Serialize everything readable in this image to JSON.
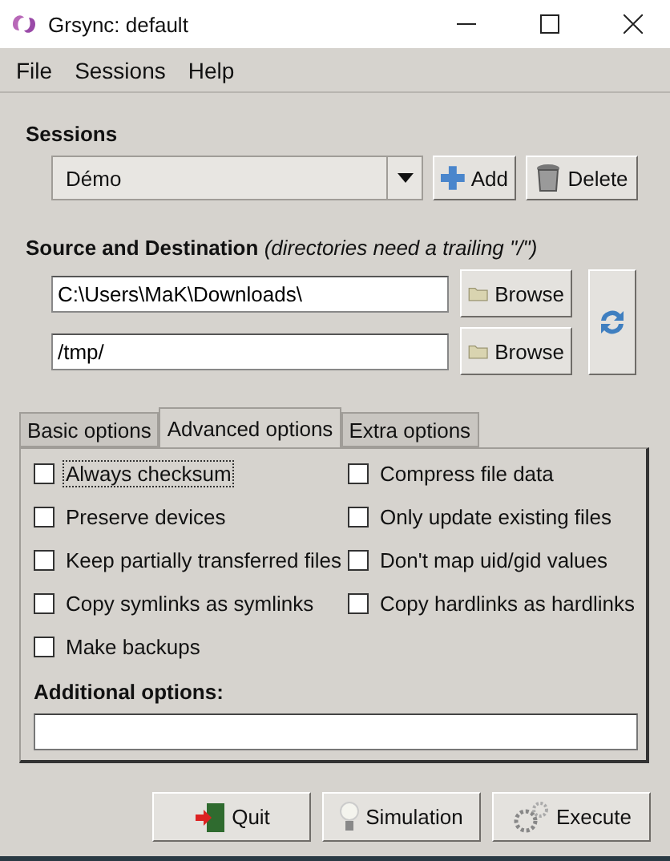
{
  "window": {
    "title": "Grsync: default"
  },
  "menu": [
    "File",
    "Sessions",
    "Help"
  ],
  "sessions": {
    "heading": "Sessions",
    "selected_session": "Démo",
    "buttons": [
      {
        "label": "Add",
        "kind": "add"
      },
      {
        "label": "Delete",
        "kind": "delete"
      }
    ]
  },
  "source_destination": {
    "heading": "Source and Destination",
    "hint": "(directories need a trailing \"/\")",
    "paths": [
      {
        "value": "C:\\Users\\MaK\\Downloads\\",
        "browse": "Browse"
      },
      {
        "value": "/tmp/",
        "browse": "Browse"
      }
    ]
  },
  "tabs": [
    {
      "label": "Basic options",
      "selected": false
    },
    {
      "label": "Advanced options",
      "selected": true
    },
    {
      "label": "Extra options",
      "selected": false
    }
  ],
  "options": [
    {
      "label": "Always checksum",
      "checked": false,
      "focused": true
    },
    {
      "label": "Compress file data",
      "checked": false,
      "focused": false
    },
    {
      "label": "Preserve devices",
      "checked": false,
      "focused": false
    },
    {
      "label": "Only update existing files",
      "checked": false,
      "focused": false
    },
    {
      "label": "Keep partially transferred files",
      "checked": false,
      "focused": false
    },
    {
      "label": "Don't map uid/gid values",
      "checked": false,
      "focused": false
    },
    {
      "label": "Copy symlinks as symlinks",
      "checked": false,
      "focused": false
    },
    {
      "label": "Copy hardlinks as hardlinks",
      "checked": false,
      "focused": false
    },
    {
      "label": "Make backups",
      "checked": false,
      "focused": false
    }
  ],
  "additional_options": {
    "label": "Additional options:"
  },
  "actions": [
    {
      "label": "Quit",
      "kind": "quit"
    },
    {
      "label": "Simulation",
      "kind": "simulation"
    },
    {
      "label": "Execute",
      "kind": "execute"
    }
  ]
}
